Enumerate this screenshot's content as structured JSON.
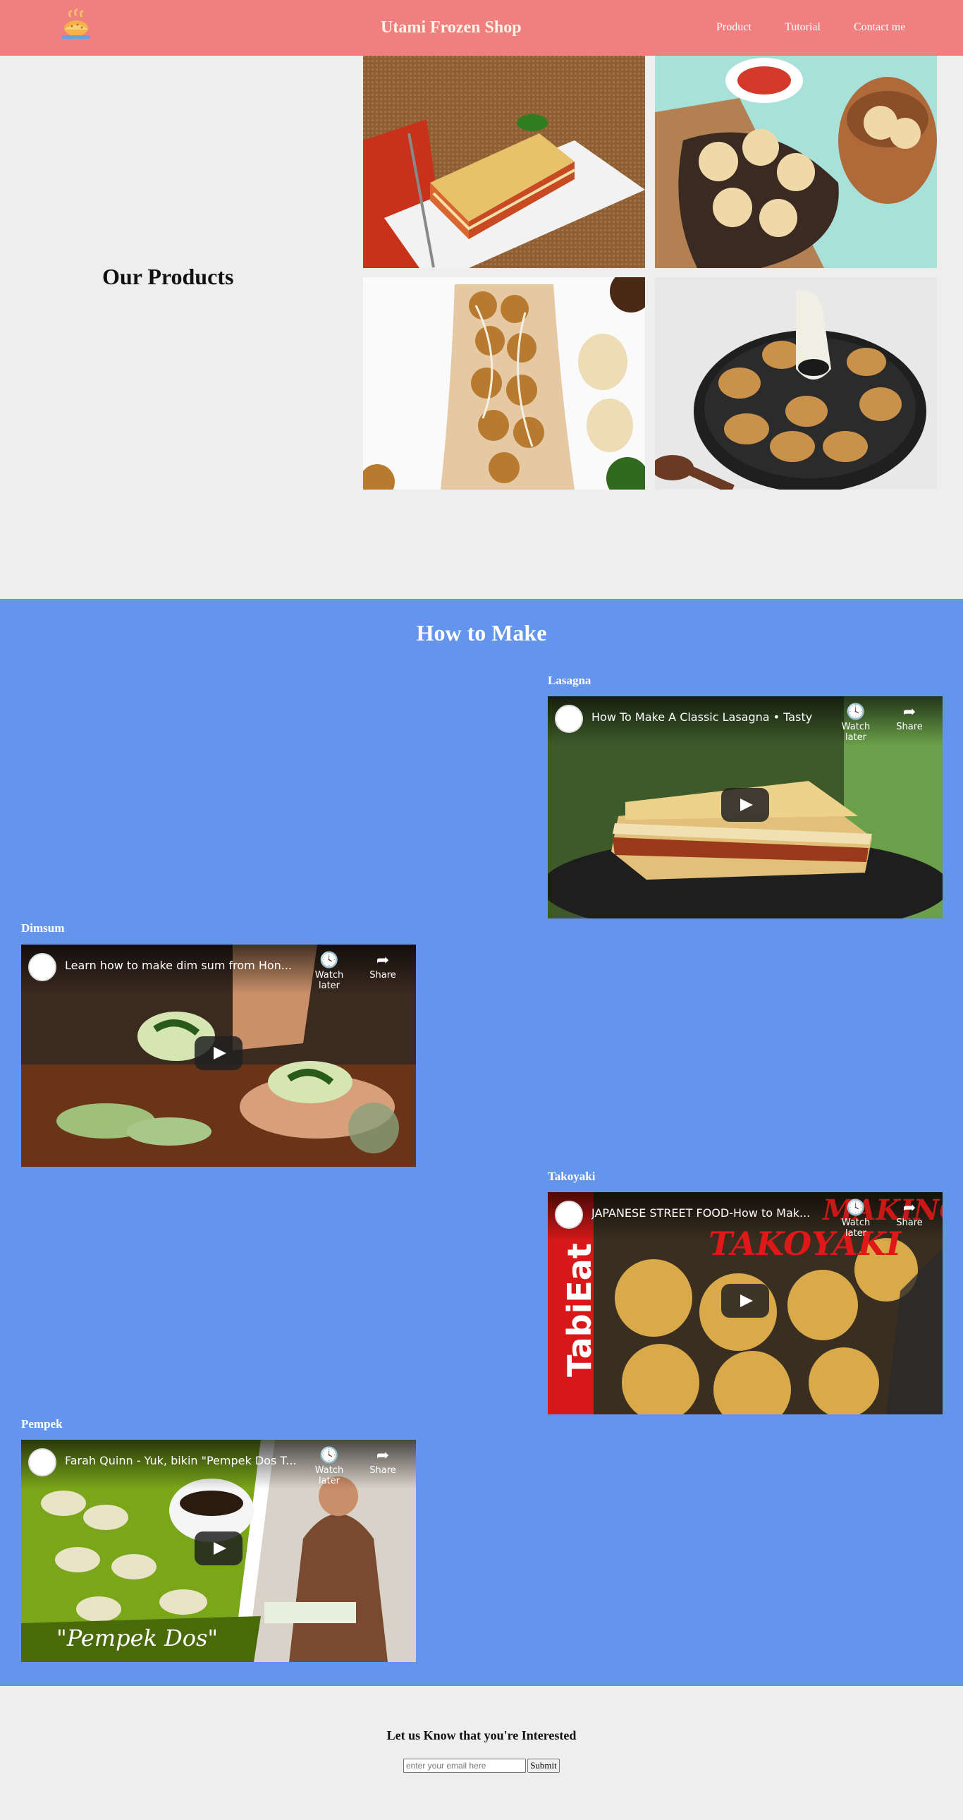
{
  "header": {
    "brand": "Utami Frozen Shop",
    "logo_icon": "food-logo-icon",
    "nav": [
      {
        "label": "Product"
      },
      {
        "label": "Tutorial"
      },
      {
        "label": "Contact me"
      }
    ],
    "background_color": "#f08080"
  },
  "products": {
    "title": "Our Products",
    "images": [
      {
        "name": "lasagna-image"
      },
      {
        "name": "dimsum-image"
      },
      {
        "name": "takoyaki-image"
      },
      {
        "name": "pempek-image"
      }
    ]
  },
  "tutorial": {
    "title": "How to Make",
    "background_color": "#6495ed",
    "videos": [
      {
        "label": "Lasagna",
        "title": "How To Make A Classic Lasagna • Tasty",
        "watch_later": "Watch later",
        "share": "Share"
      },
      {
        "label": "Dimsum",
        "title": "Learn how to make dim sum from Hon...",
        "watch_later": "Watch later",
        "share": "Share"
      },
      {
        "label": "Takoyaki",
        "title": "JAPANESE STREET FOOD-How to Mak...",
        "watch_later": "Watch later",
        "share": "Share",
        "overlay_top": "MAKING",
        "overlay_bottom": "TAKOYAKI",
        "side_brand": "TabiEat"
      },
      {
        "label": "Pempek",
        "title": "Farah Quinn - Yuk, bikin \"Pempek Dos T...",
        "watch_later": "Watch later",
        "share": "Share",
        "overlay_caption": "\"Pempek Dos\""
      }
    ]
  },
  "contact": {
    "title": "Let us Know that you're Interested",
    "email_placeholder": "enter your email here",
    "submit_label": "Submit"
  }
}
